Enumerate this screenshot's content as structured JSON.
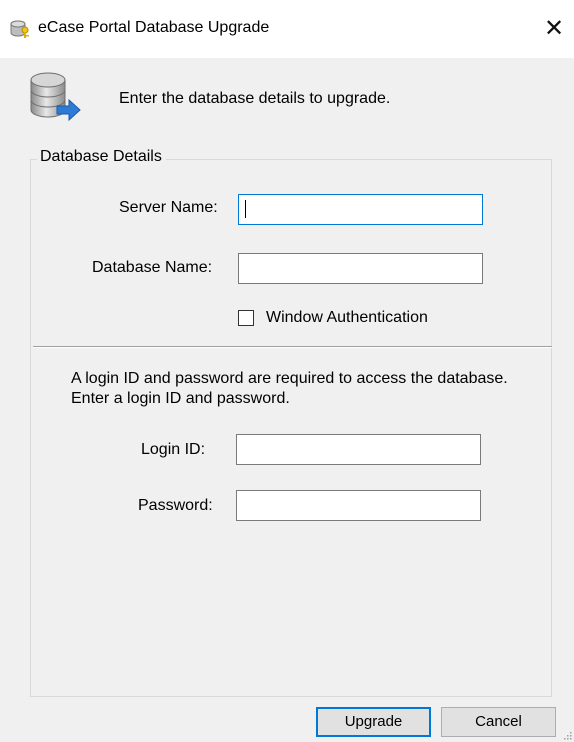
{
  "window": {
    "title": "eCase Portal Database Upgrade",
    "close_glyph": "✕",
    "title_icon": "database-key-icon"
  },
  "header": {
    "icon": "database-upgrade-icon",
    "text": "Enter the database details to upgrade."
  },
  "database_details": {
    "group_label": "Database Details",
    "server_name_label": "Server Name:",
    "server_name_value": "",
    "database_name_label": "Database Name:",
    "database_name_value": "",
    "window_auth_label": "Window Authentication",
    "window_auth_checked": false
  },
  "login": {
    "info_text": "A login ID and password are required to access the database. Enter a login ID and password.",
    "login_id_label": "Login ID:",
    "login_id_value": "",
    "password_label": "Password:",
    "password_value": ""
  },
  "buttons": {
    "upgrade": "Upgrade",
    "cancel": "Cancel"
  },
  "colors": {
    "accent": "#0078d7",
    "window_bg": "#f0f0f0"
  }
}
